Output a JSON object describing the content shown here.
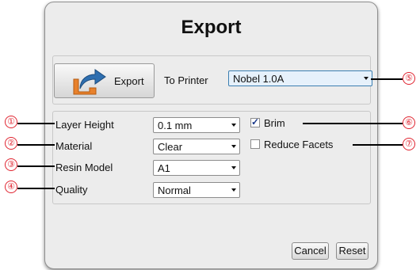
{
  "dialog": {
    "title": "Export",
    "export_button": {
      "label": "Export",
      "icon": "share-arrow-icon"
    },
    "to_printer": {
      "label": "To Printer",
      "value": "Nobel 1.0A"
    },
    "settings": [
      {
        "label": "Layer Height",
        "value": "0.1 mm"
      },
      {
        "label": "Material",
        "value": "Clear"
      },
      {
        "label": "Resin Model",
        "value": "A1"
      },
      {
        "label": "Quality",
        "value": "Normal"
      }
    ],
    "options": [
      {
        "label": "Brim",
        "checked": true
      },
      {
        "label": "Reduce Facets",
        "checked": false
      }
    ],
    "buttons": {
      "cancel": "Cancel",
      "reset": "Reset"
    }
  },
  "callouts": [
    "①",
    "②",
    "③",
    "④",
    "⑤",
    "⑥",
    "⑦"
  ],
  "colors": {
    "callout": "#e0232f",
    "icon_orange": "#e8812b",
    "icon_blue": "#2f6fb0"
  }
}
